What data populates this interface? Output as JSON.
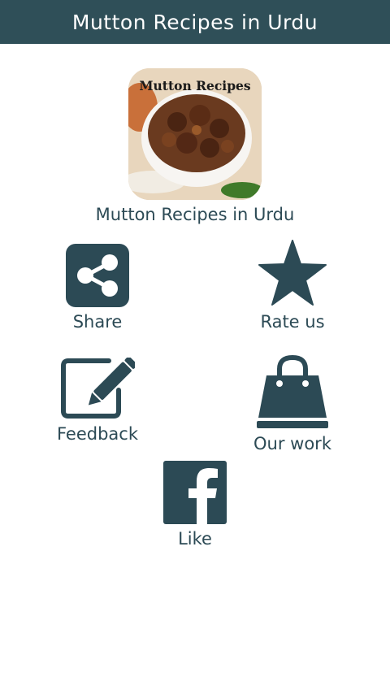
{
  "header": {
    "title": "Mutton Recipes in Urdu"
  },
  "app_image": {
    "caption": "Mutton Recipes"
  },
  "app_name": "Mutton Recipes in Urdu",
  "actions": [
    {
      "label": "Share",
      "icon": "share-icon"
    },
    {
      "label": "Rate us",
      "icon": "star-icon"
    },
    {
      "label": "Feedback",
      "icon": "edit-icon"
    },
    {
      "label": "Our work",
      "icon": "shopping-bag-icon"
    },
    {
      "label": "Like",
      "icon": "facebook-icon"
    }
  ],
  "colors": {
    "header_bg": "#2f4f58",
    "icon": "#2c4a55",
    "background": "#ffffff"
  }
}
